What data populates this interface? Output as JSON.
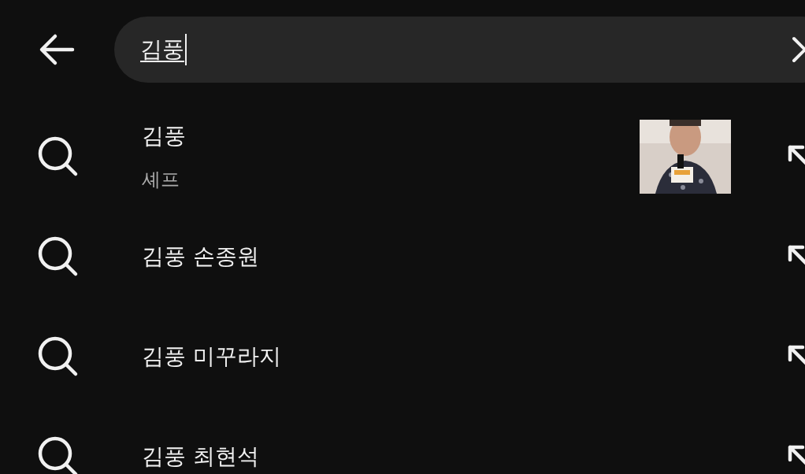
{
  "search": {
    "value": "김풍",
    "composing": true
  },
  "suggestions": [
    {
      "text": "김풍",
      "subtitle": "셰프"
    },
    {
      "text": "김풍 손종원"
    },
    {
      "text": "김풍 미꾸라지"
    },
    {
      "text": "김풍 최현석"
    }
  ]
}
